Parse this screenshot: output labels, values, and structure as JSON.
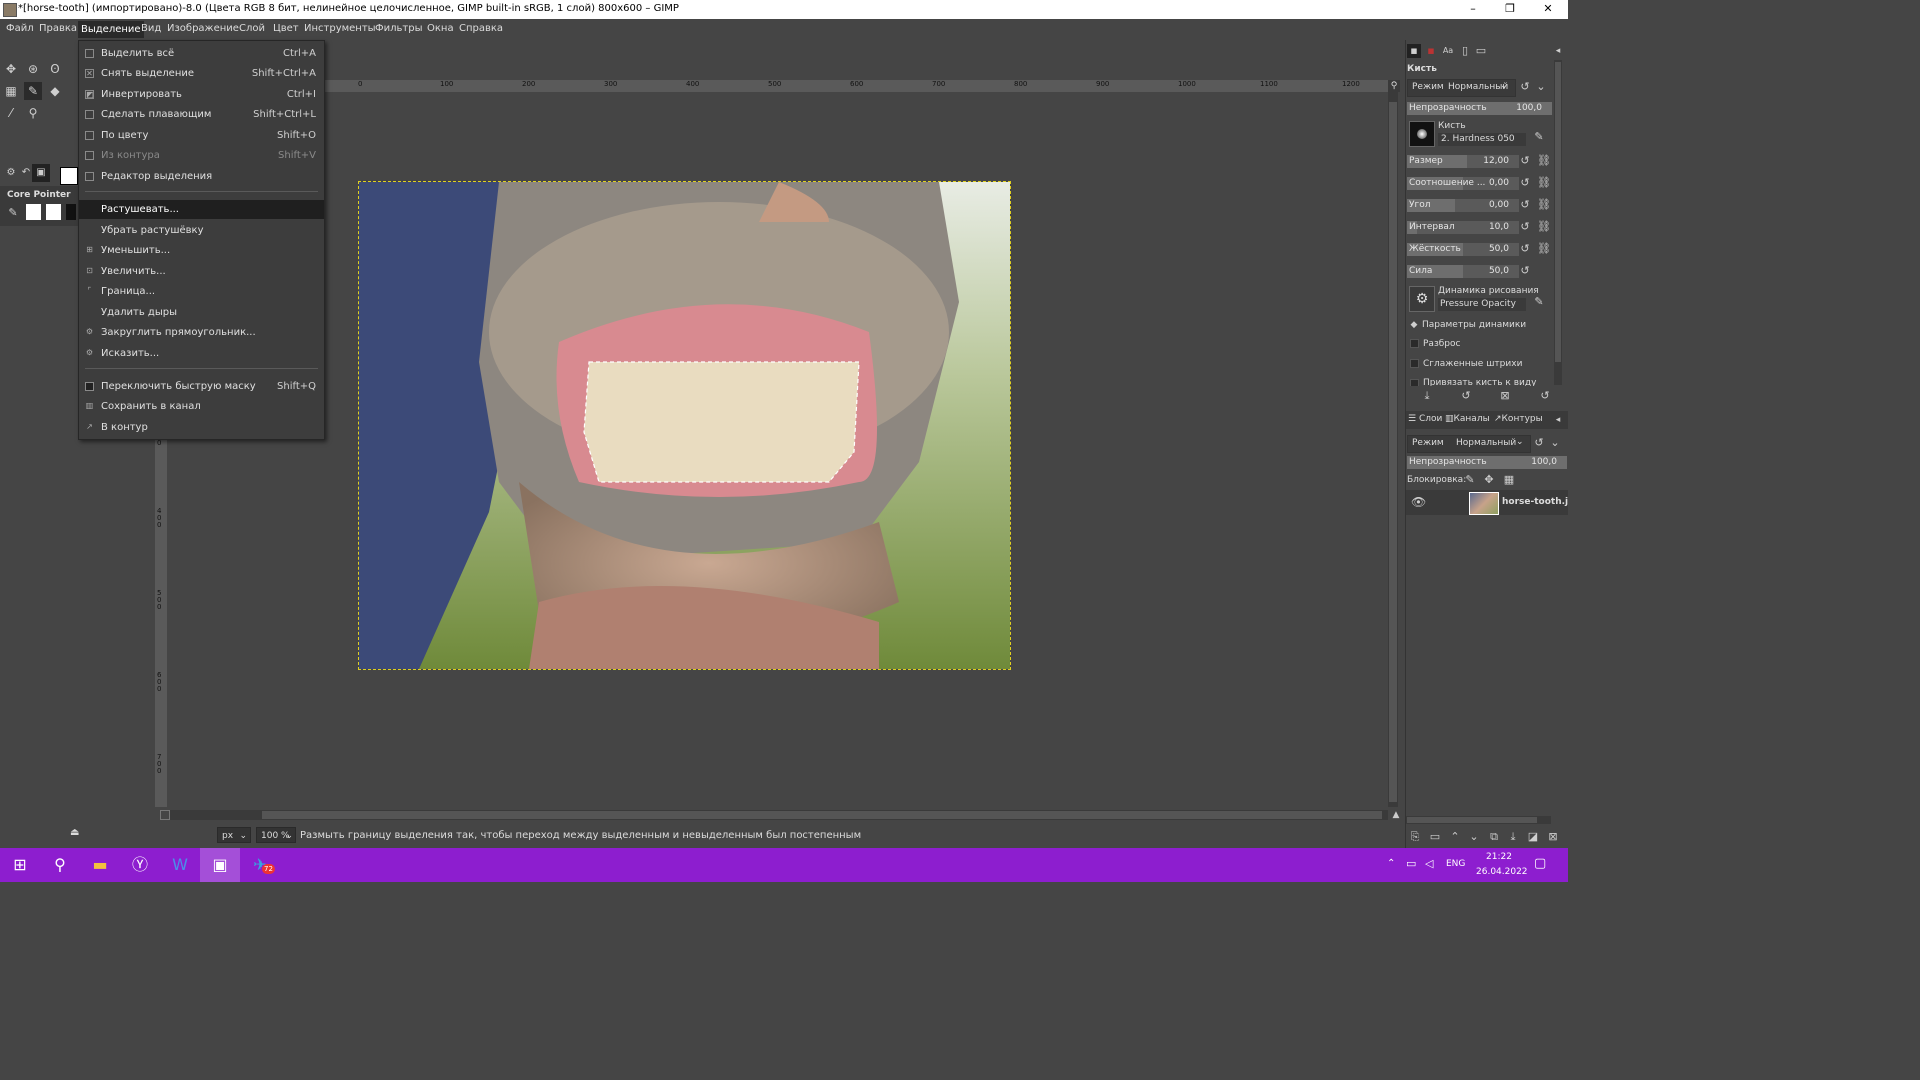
{
  "window": {
    "title": "*[horse-tooth] (импортировано)-8.0 (Цвета RGB 8 бит, нелинейное целочисленное, GIMP built-in sRGB, 1 слой) 800x600 – GIMP",
    "minimize": "–",
    "maximize": "❐",
    "close": "✕"
  },
  "menubar": [
    {
      "label": "Файл"
    },
    {
      "label": "Правка"
    },
    {
      "label": "Выделение",
      "active": true
    },
    {
      "label": "Вид"
    },
    {
      "label": "Изображение"
    },
    {
      "label": "Слой"
    },
    {
      "label": "Цвет"
    },
    {
      "label": "Инструменты"
    },
    {
      "label": "Фильтры"
    },
    {
      "label": "Окна"
    },
    {
      "label": "Справка"
    }
  ],
  "select_menu": [
    {
      "label": "Выделить всё",
      "shortcut": "Ctrl+A",
      "icon": "select-all-icon",
      "glyph": ""
    },
    {
      "label": "Снять выделение",
      "shortcut": "Shift+Ctrl+A",
      "icon": "select-none-icon",
      "glyph": "✕"
    },
    {
      "label": "Инвертировать",
      "shortcut": "Ctrl+I",
      "icon": "invert-selection-icon",
      "glyph": "◩"
    },
    {
      "label": "Сделать плавающим",
      "shortcut": "Shift+Ctrl+L",
      "icon": "float-selection-icon",
      "glyph": ""
    },
    {
      "label": "По цвету",
      "shortcut": "Shift+O",
      "icon": "by-color-icon",
      "glyph": ""
    },
    {
      "label": "Из контура",
      "shortcut": "Shift+V",
      "icon": "from-path-icon",
      "glyph": "",
      "disabled": true
    },
    {
      "label": "Редактор выделения",
      "shortcut": "",
      "icon": "selection-editor-icon",
      "glyph": ""
    },
    {
      "label": "Растушевать...",
      "shortcut": "",
      "icon": "",
      "glyph": "",
      "highlighted": true
    },
    {
      "label": "Убрать растушёвку",
      "shortcut": "",
      "icon": "",
      "glyph": ""
    },
    {
      "label": "Уменьшить...",
      "shortcut": "",
      "icon": "shrink-icon",
      "glyph": "⊞"
    },
    {
      "label": "Увеличить...",
      "shortcut": "",
      "icon": "grow-icon",
      "glyph": "⊡"
    },
    {
      "label": "Граница...",
      "shortcut": "",
      "icon": "border-icon",
      "glyph": "⌜"
    },
    {
      "label": "Удалить дыры",
      "shortcut": "",
      "icon": "",
      "glyph": ""
    },
    {
      "label": "Закруглить прямоугольник...",
      "shortcut": "",
      "icon": "round-rect-icon",
      "glyph": "⚙"
    },
    {
      "label": "Исказить...",
      "shortcut": "",
      "icon": "distort-icon",
      "glyph": "⚙"
    },
    {
      "label": "Переключить быструю маску",
      "shortcut": "Shift+Q",
      "icon": "quick-mask-icon",
      "glyph": ""
    },
    {
      "label": "Сохранить в канал",
      "shortcut": "",
      "icon": "save-to-channel-icon",
      "glyph": "▥"
    },
    {
      "label": "В контур",
      "shortcut": "",
      "icon": "to-path-icon",
      "glyph": "↗"
    }
  ],
  "toolbox": {
    "device_label": "Core Pointer"
  },
  "rulers": {
    "h_ticks": [
      "0",
      "100",
      "200",
      "300",
      "400",
      "500",
      "600",
      "700",
      "800",
      "900",
      "1000",
      "1100",
      "1200"
    ],
    "v_ticks": [
      "300",
      "400",
      "500",
      "600",
      "700"
    ]
  },
  "statusbar": {
    "unit": "px",
    "zoom": "100 %",
    "message": "Размыть границу выделения так, чтобы переход между выделенным и невыделенным был постепенным"
  },
  "tool_options": {
    "title": "Кисть",
    "mode_label": "Режим",
    "mode_value": "Нормальный",
    "opacity": {
      "label": "Непрозрачность",
      "value": "100,0"
    },
    "brush_label": "Кисть",
    "brush_value": "2. Hardness 050",
    "size": {
      "label": "Размер",
      "value": "12,00"
    },
    "aspect": {
      "label": "Соотношение ...",
      "value": "0,00"
    },
    "angle": {
      "label": "Угол",
      "value": "0,00"
    },
    "spacing": {
      "label": "Интервал",
      "value": "10,0"
    },
    "hardness": {
      "label": "Жёсткость",
      "value": "50,0"
    },
    "force": {
      "label": "Сила",
      "value": "50,0"
    },
    "dynamics_label": "Динамика рисования",
    "dynamics_value": "Pressure Opacity",
    "dyn_options": "Параметры динамики",
    "scatter": "Разброс",
    "smooth": "Сглаженные штрихи",
    "lock_view": "Привязать кисть к виду"
  },
  "layers_panel": {
    "tab_layers": "Слои",
    "tab_channels": "Каналы",
    "tab_paths": "Контуры",
    "mode_label": "Режим",
    "mode_value": "Нормальный",
    "opacity_label": "Непрозрачность",
    "opacity_value": "100,0",
    "lock_label": "Блокировка:",
    "layer_name": "horse-tooth.j"
  },
  "taskbar": {
    "lang": "ENG",
    "time": "21:22",
    "date": "26.04.2022",
    "telegram_badge": "72"
  },
  "colors": {
    "taskbar": "#8d1ecf",
    "selection_marching": "#e0d020",
    "gimp_bg": "#454545"
  }
}
